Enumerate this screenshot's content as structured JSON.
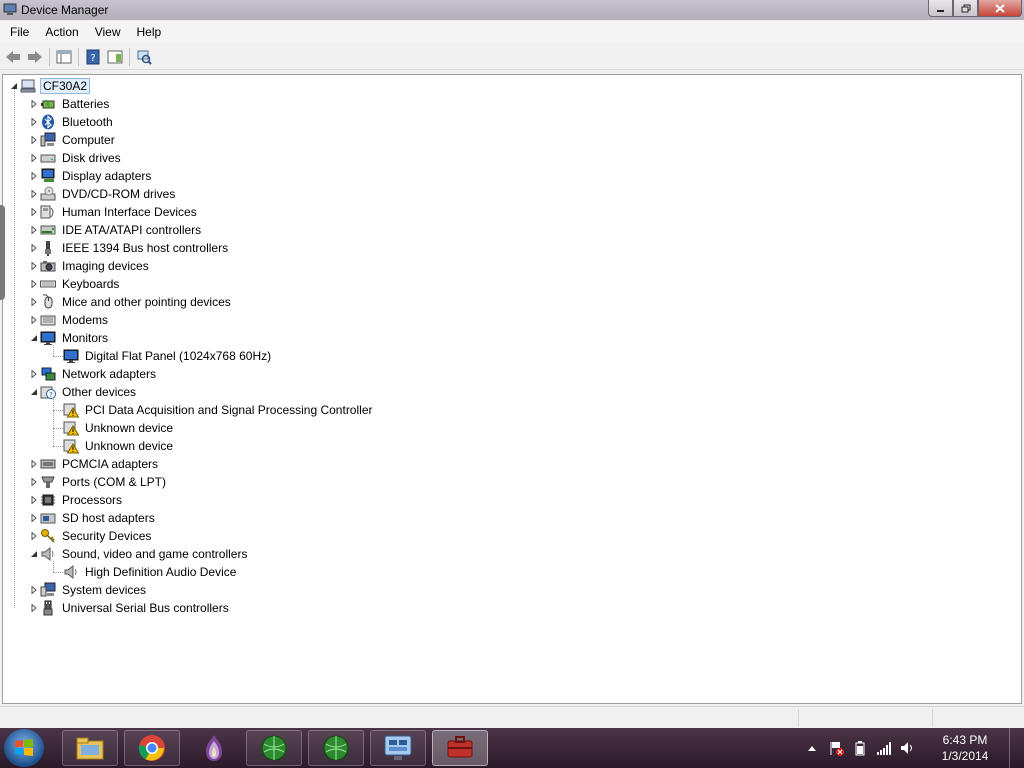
{
  "window": {
    "title": "Device Manager"
  },
  "menu": [
    "File",
    "Action",
    "View",
    "Help"
  ],
  "tree": {
    "root": "CF30A2",
    "items": [
      {
        "label": "Batteries",
        "icon": "battery-icon",
        "level": 1,
        "expanded": false
      },
      {
        "label": "Bluetooth",
        "icon": "bluetooth-icon",
        "level": 1,
        "expanded": false
      },
      {
        "label": "Computer",
        "icon": "computer-icon",
        "level": 1,
        "expanded": false
      },
      {
        "label": "Disk drives",
        "icon": "disk-drive-icon",
        "level": 1,
        "expanded": false
      },
      {
        "label": "Display adapters",
        "icon": "display-adapter-icon",
        "level": 1,
        "expanded": false
      },
      {
        "label": "DVD/CD-ROM drives",
        "icon": "dvd-drive-icon",
        "level": 1,
        "expanded": false
      },
      {
        "label": "Human Interface Devices",
        "icon": "hid-icon",
        "level": 1,
        "expanded": false
      },
      {
        "label": "IDE ATA/ATAPI controllers",
        "icon": "ide-controller-icon",
        "level": 1,
        "expanded": false
      },
      {
        "label": "IEEE 1394 Bus host controllers",
        "icon": "ieee1394-icon",
        "level": 1,
        "expanded": false
      },
      {
        "label": "Imaging devices",
        "icon": "camera-icon",
        "level": 1,
        "expanded": false
      },
      {
        "label": "Keyboards",
        "icon": "keyboard-icon",
        "level": 1,
        "expanded": false
      },
      {
        "label": "Mice and other pointing devices",
        "icon": "mouse-icon",
        "level": 1,
        "expanded": false
      },
      {
        "label": "Modems",
        "icon": "modem-icon",
        "level": 1,
        "expanded": false
      },
      {
        "label": "Monitors",
        "icon": "monitor-icon",
        "level": 1,
        "expanded": true
      },
      {
        "label": "Digital Flat Panel (1024x768 60Hz)",
        "icon": "monitor-icon",
        "level": 2
      },
      {
        "label": "Network adapters",
        "icon": "network-adapter-icon",
        "level": 1,
        "expanded": false
      },
      {
        "label": "Other devices",
        "icon": "unknown-device-icon",
        "level": 1,
        "expanded": true
      },
      {
        "label": "PCI Data Acquisition and Signal Processing Controller",
        "icon": "warning-device-icon",
        "level": 2
      },
      {
        "label": "Unknown device",
        "icon": "warning-device-icon",
        "level": 2
      },
      {
        "label": "Unknown device",
        "icon": "warning-device-icon",
        "level": 2
      },
      {
        "label": "PCMCIA adapters",
        "icon": "pcmcia-icon",
        "level": 1,
        "expanded": false
      },
      {
        "label": "Ports (COM & LPT)",
        "icon": "port-icon",
        "level": 1,
        "expanded": false
      },
      {
        "label": "Processors",
        "icon": "processor-icon",
        "level": 1,
        "expanded": false
      },
      {
        "label": "SD host adapters",
        "icon": "sd-adapter-icon",
        "level": 1,
        "expanded": false
      },
      {
        "label": "Security Devices",
        "icon": "key-icon",
        "level": 1,
        "expanded": false
      },
      {
        "label": "Sound, video and game controllers",
        "icon": "speaker-icon",
        "level": 1,
        "expanded": true
      },
      {
        "label": "High Definition Audio Device",
        "icon": "speaker-icon",
        "level": 2
      },
      {
        "label": "System devices",
        "icon": "system-device-icon",
        "level": 1,
        "expanded": false
      },
      {
        "label": "Universal Serial Bus controllers",
        "icon": "usb-icon",
        "level": 1,
        "expanded": false
      }
    ]
  },
  "taskbar": {
    "apps": [
      "file-explorer-icon",
      "chrome-icon",
      "tor-onion-icon",
      "green-globe-icon",
      "green-globe-icon",
      "control-panel-icon",
      "device-manager-icon"
    ],
    "clock_time": "6:43 PM",
    "clock_date": "1/3/2014"
  },
  "colors": {
    "selection": "#e3eefb",
    "title_bar": "#b3adbb",
    "taskbar": "#3a2437",
    "warning": "#f2c200"
  }
}
